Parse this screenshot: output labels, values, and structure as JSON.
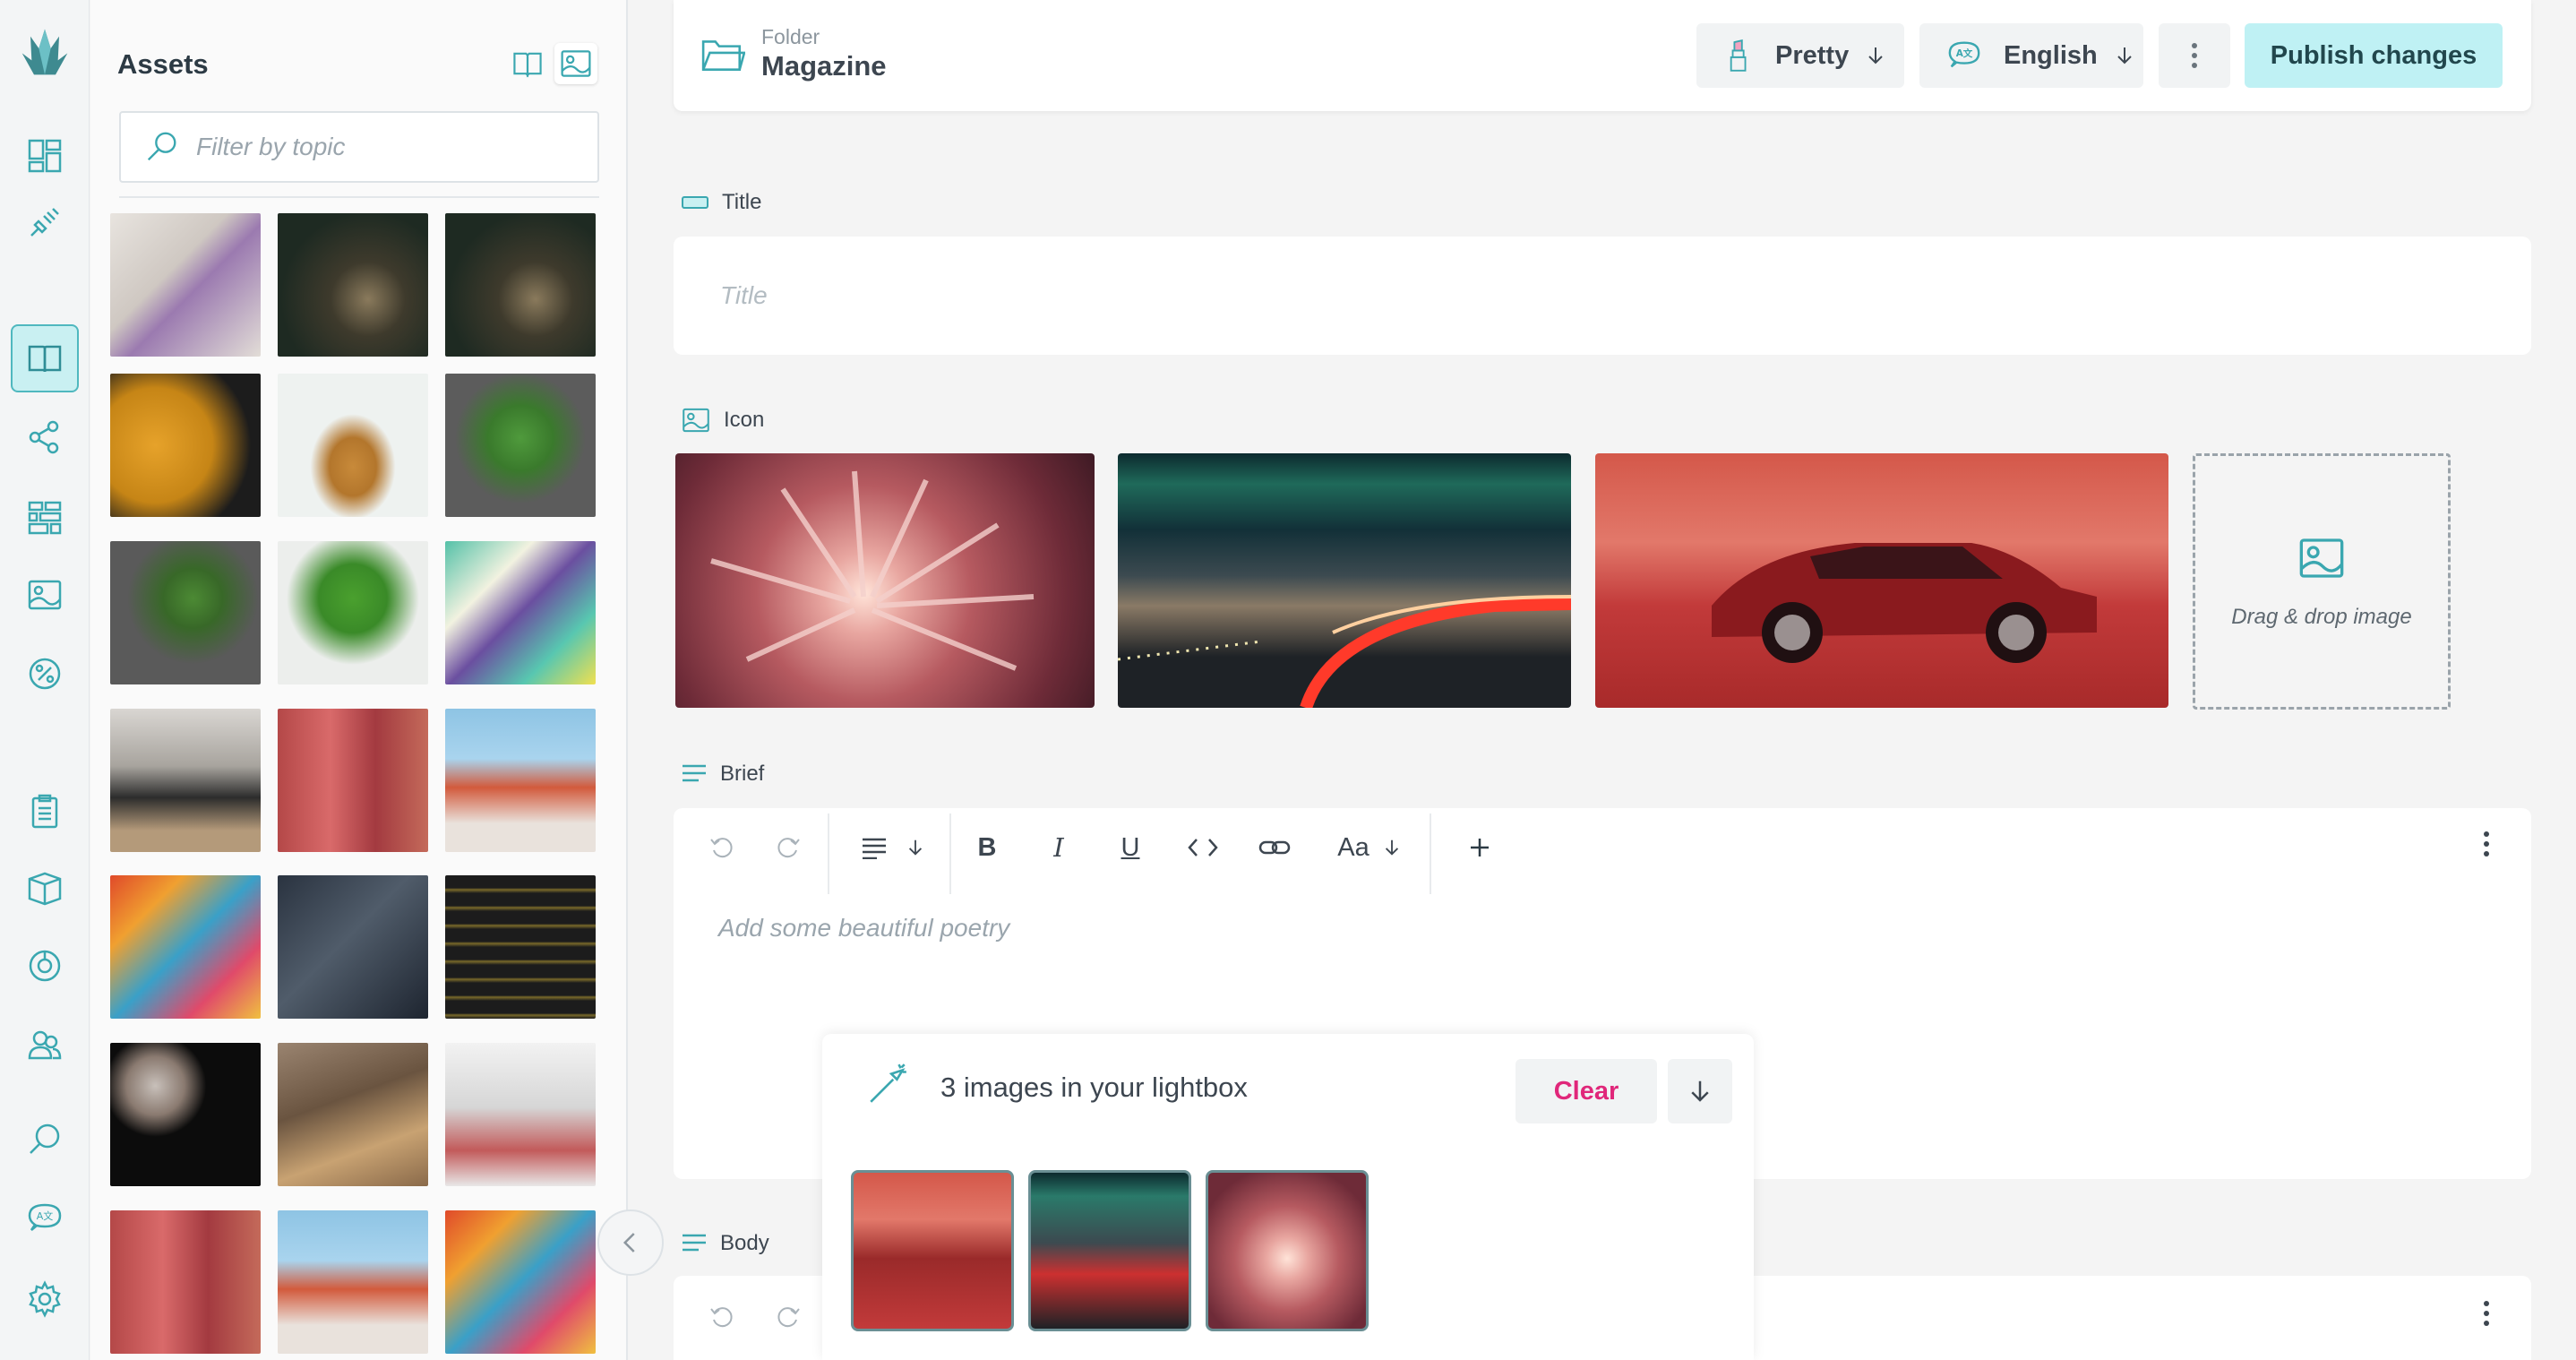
{
  "rail": {
    "items": [
      "logo-icon",
      "dashboard-icon",
      "plug-icon",
      "book-icon",
      "share-icon",
      "blocks-icon",
      "image-icon",
      "percent-icon",
      "clipboard-icon",
      "cube-icon",
      "chart-pie-icon",
      "users-icon",
      "search-icon",
      "translate-icon",
      "gear-icon"
    ],
    "active": "book-icon"
  },
  "assets": {
    "title": "Assets",
    "filter_placeholder": "Filter by topic",
    "thumbnails": [
      "lilac-flowers",
      "dark-still-life",
      "dark-still-life",
      "sunflower",
      "pineapple",
      "pilea-plant",
      "pilea-plant-pot",
      "pilea-plant-white",
      "sticker-art",
      "living-room",
      "red-textile-room",
      "market-street",
      "colorful-rug",
      "dark-fabric",
      "spools-rows",
      "yarn-spools",
      "woven-basket",
      "white-drapes",
      "red-textile-room",
      "market-street",
      "colorful-rug"
    ]
  },
  "header": {
    "folder_label": "Folder",
    "folder_name": "Magazine",
    "pretty_label": "Pretty",
    "language_label": "English",
    "publish_label": "Publish changes"
  },
  "fields": {
    "title_label": "Title",
    "title_placeholder": "Title",
    "icon_label": "Icon",
    "dropzone_label": "Drag & drop image",
    "brief_label": "Brief",
    "brief_placeholder": "Add some beautiful poetry",
    "body_label": "Body",
    "font_button": "Aa"
  },
  "lightbox": {
    "title": "3 images in your lightbox",
    "clear_label": "Clear"
  },
  "colors": {
    "accent": "#4fb8bf",
    "publish_bg": "#bff1f4",
    "clear_text": "#e0277a"
  }
}
